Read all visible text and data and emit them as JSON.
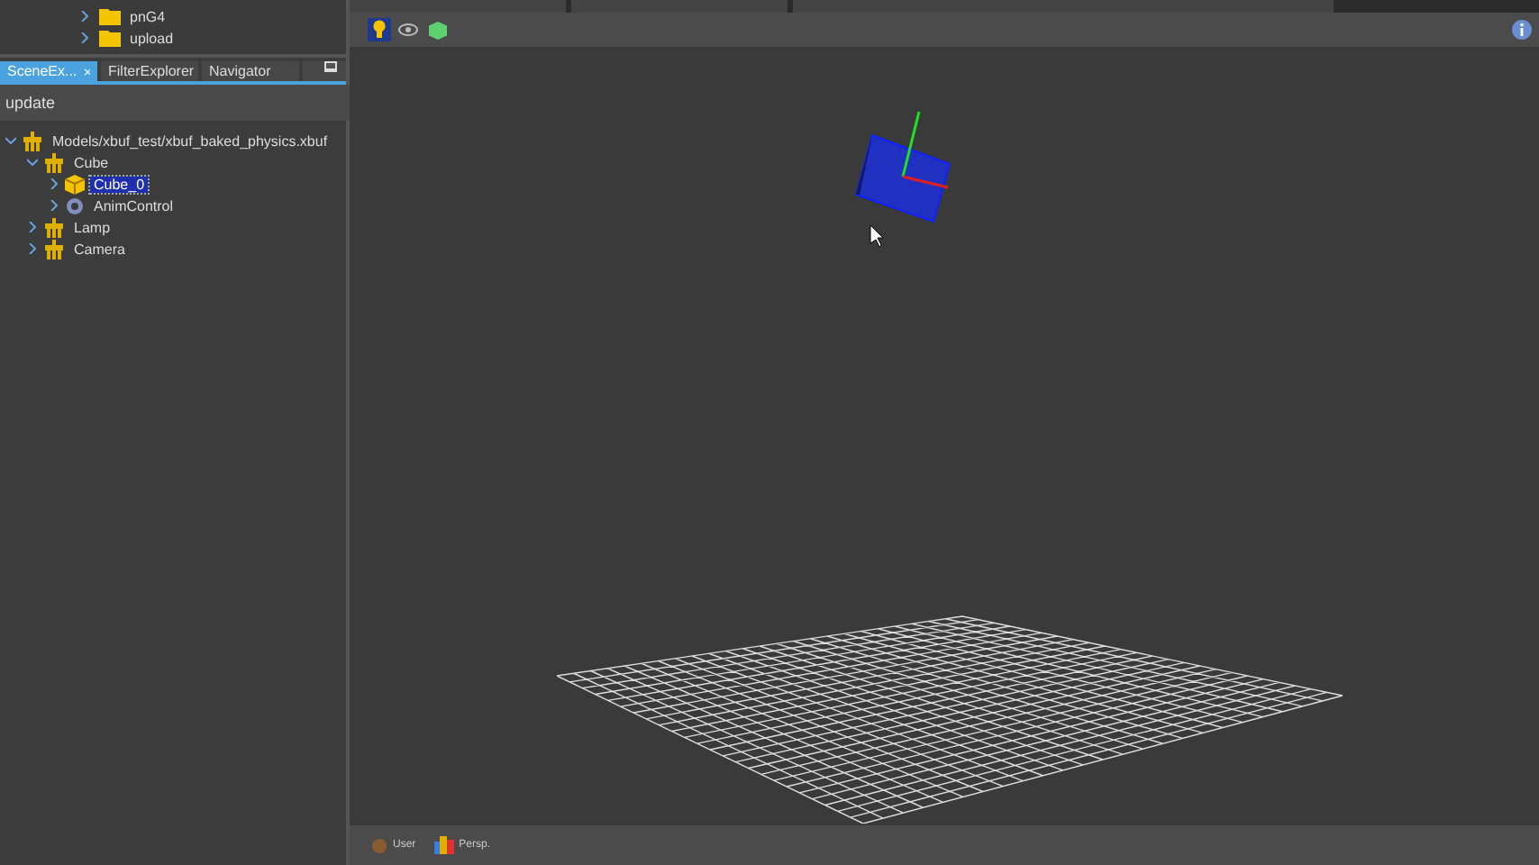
{
  "file_tree": [
    {
      "label": "pnG4",
      "kind": "folder"
    },
    {
      "label": "upload",
      "kind": "folder"
    }
  ],
  "panel_tabs": [
    {
      "label": "SceneEx...",
      "selected": true,
      "closable": true
    },
    {
      "label": "FilterExplorer",
      "selected": false,
      "closable": false
    },
    {
      "label": "Navigator",
      "selected": false,
      "closable": false
    }
  ],
  "search": {
    "value": "update"
  },
  "scene_tree": [
    {
      "label": "Models/xbuf_test/xbuf_baked_physics.xbuf",
      "kind": "node",
      "selected": false,
      "expanded": true,
      "children": [
        {
          "label": "Cube",
          "kind": "node",
          "selected": false,
          "expanded": true,
          "children": [
            {
              "label": "Cube_0",
              "kind": "geometry",
              "selected": true,
              "expanded": false
            },
            {
              "label": "AnimControl",
              "kind": "control",
              "selected": false,
              "expanded": false
            }
          ]
        },
        {
          "label": "Lamp",
          "kind": "node",
          "selected": false,
          "expanded": false
        },
        {
          "label": "Camera",
          "kind": "node",
          "selected": false,
          "expanded": false
        }
      ]
    }
  ],
  "toolbar": [
    {
      "kind": "light",
      "selected": true
    },
    {
      "kind": "eye",
      "selected": false
    },
    {
      "kind": "cube",
      "selected": false
    }
  ],
  "status_bar": [
    {
      "label": "User",
      "kind": "user"
    },
    {
      "label": "Persp.",
      "kind": "persp"
    }
  ]
}
